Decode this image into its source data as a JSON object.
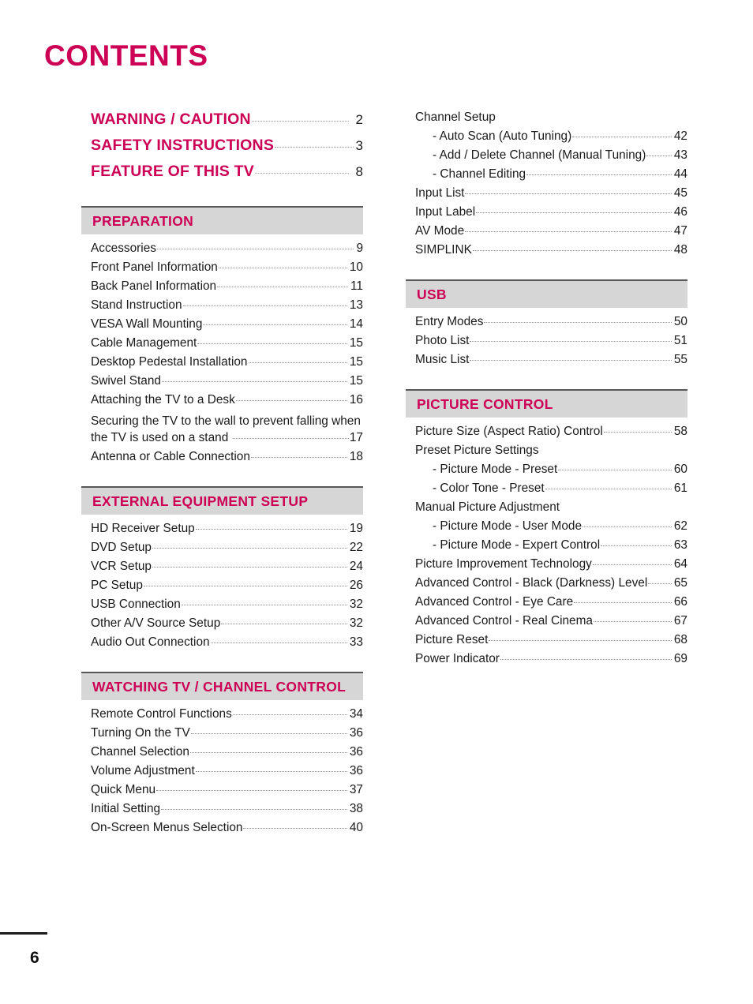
{
  "page": {
    "title": "CONTENTS",
    "number": "6",
    "accent_color": "#CC0055",
    "section_bar_color": "#D6D6D6",
    "section_rule_color": "#585858"
  },
  "toplevel": [
    {
      "label": "WARNING / CAUTION",
      "page": "2"
    },
    {
      "label": "SAFETY INSTRUCTIONS",
      "page": "3"
    },
    {
      "label": "FEATURE OF THIS TV",
      "page": "8"
    }
  ],
  "left_column": {
    "sections": [
      {
        "title": "PREPARATION",
        "entries": [
          {
            "label": "Accessories",
            "page": "9"
          },
          {
            "label": "Front Panel Information",
            "page": "10"
          },
          {
            "label": "Back Panel Information",
            "page": "11"
          },
          {
            "label": "Stand Instruction",
            "page": "13"
          },
          {
            "label": "VESA Wall Mounting",
            "page": "14"
          },
          {
            "label": "Cable Management",
            "page": "15"
          },
          {
            "label": "Desktop Pedestal Installation",
            "page": "15"
          },
          {
            "label": "Swivel Stand",
            "page": "15"
          },
          {
            "label": "Attaching the TV to a Desk",
            "page": "16"
          },
          {
            "label": "Securing the TV to the wall to prevent falling when the TV is used on a stand",
            "line1": "Securing the TV to the wall to prevent falling when",
            "line2": "the TV is used on a stand",
            "page": "17",
            "wrapped": true
          },
          {
            "label": "Antenna or Cable Connection",
            "page": "18"
          }
        ]
      },
      {
        "title": "EXTERNAL EQUIPMENT SETUP",
        "entries": [
          {
            "label": "HD Receiver Setup",
            "page": "19"
          },
          {
            "label": "DVD Setup",
            "page": "22"
          },
          {
            "label": "VCR Setup",
            "page": "24"
          },
          {
            "label": "PC Setup",
            "page": "26"
          },
          {
            "label": "USB Connection",
            "page": "32"
          },
          {
            "label": "Other A/V Source Setup",
            "page": "32"
          },
          {
            "label": "Audio Out Connection",
            "page": "33"
          }
        ]
      },
      {
        "title": "WATCHING TV / CHANNEL CONTROL",
        "entries": [
          {
            "label": "Remote Control Functions",
            "page": "34"
          },
          {
            "label": "Turning On the TV",
            "page": "36"
          },
          {
            "label": "Channel Selection",
            "page": "36"
          },
          {
            "label": "Volume Adjustment",
            "page": "36"
          },
          {
            "label": "Quick Menu",
            "page": "37"
          },
          {
            "label": "Initial Setting",
            "page": "38"
          },
          {
            "label": "On-Screen Menus Selection",
            "page": "40"
          }
        ]
      }
    ]
  },
  "right_column": {
    "continued_entries": [
      {
        "label": "Channel Setup",
        "page": "",
        "heading": true
      },
      {
        "label": "- Auto Scan (Auto Tuning)",
        "page": "42",
        "indent": true
      },
      {
        "label": "- Add / Delete Channel (Manual Tuning)",
        "page": "43",
        "indent": true
      },
      {
        "label": "- Channel Editing",
        "page": "44",
        "indent": true
      },
      {
        "label": "Input List",
        "page": "45"
      },
      {
        "label": "Input Label",
        "page": "46"
      },
      {
        "label": "AV Mode",
        "page": "47"
      },
      {
        "label": "SIMPLINK",
        "page": "48"
      }
    ],
    "sections": [
      {
        "title": "USB",
        "entries": [
          {
            "label": "Entry Modes",
            "page": "50"
          },
          {
            "label": "Photo List",
            "page": "51"
          },
          {
            "label": "Music List",
            "page": "55"
          }
        ]
      },
      {
        "title": "PICTURE CONTROL",
        "entries": [
          {
            "label": "Picture Size (Aspect Ratio) Control",
            "page": "58"
          },
          {
            "label": "Preset Picture Settings",
            "page": "",
            "heading": true
          },
          {
            "label": "- Picture Mode - Preset",
            "page": "60",
            "indent": true
          },
          {
            "label": "- Color Tone - Preset",
            "page": "61",
            "indent": true
          },
          {
            "label": "Manual Picture Adjustment",
            "page": "",
            "heading": true
          },
          {
            "label": "- Picture Mode - User Mode",
            "page": "62",
            "indent": true
          },
          {
            "label": "- Picture Mode - Expert Control",
            "page": "63",
            "indent": true
          },
          {
            "label": "Picture Improvement Technology",
            "page": "64"
          },
          {
            "label": "Advanced Control - Black (Darkness) Level",
            "page": "65"
          },
          {
            "label": "Advanced Control - Eye Care",
            "page": "66"
          },
          {
            "label": "Advanced Control - Real Cinema",
            "page": "67"
          },
          {
            "label": "Picture Reset",
            "page": "68"
          },
          {
            "label": "Power Indicator",
            "page": "69"
          }
        ]
      }
    ]
  }
}
